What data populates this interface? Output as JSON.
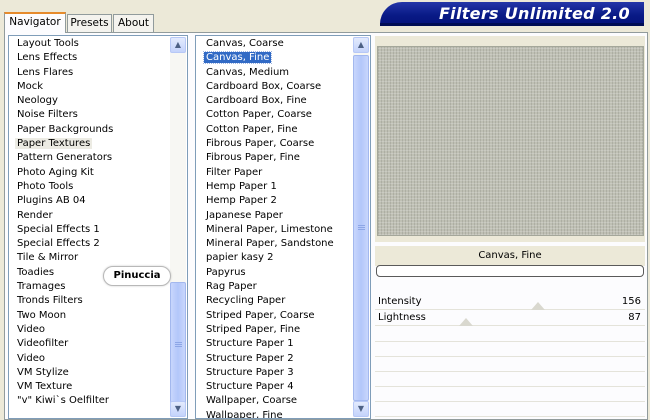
{
  "tabs": {
    "navigator": "Navigator",
    "presets": "Presets",
    "about": "About"
  },
  "title": "Filters Unlimited 2.0",
  "categories": {
    "selected": "Paper Textures",
    "items": [
      "Layout Tools",
      "Lens Effects",
      "Lens Flares",
      "Mock",
      "Neology",
      "Noise Filters",
      "Paper Backgrounds",
      "Paper Textures",
      "Pattern Generators",
      "Photo Aging Kit",
      "Photo Tools",
      "Plugins AB 04",
      "Render",
      "Special Effects 1",
      "Special Effects 2",
      "Tile & Mirror",
      "Toadies",
      "Tramages",
      "Tronds Filters",
      "Two Moon",
      "Video",
      "Videofilter",
      "Video",
      "VM Stylize",
      "VM Texture",
      "\"v\" Kiwi`s Oelfilter"
    ]
  },
  "filters": {
    "selected": "Canvas, Fine",
    "items": [
      "Canvas, Coarse",
      "Canvas, Fine",
      "Canvas, Medium",
      "Cardboard Box, Coarse",
      "Cardboard Box, Fine",
      "Cotton Paper, Coarse",
      "Cotton Paper, Fine",
      "Fibrous Paper, Coarse",
      "Fibrous Paper, Fine",
      "Filter Paper",
      "Hemp Paper 1",
      "Hemp Paper 2",
      "Japanese Paper",
      "Mineral Paper, Limestone",
      "Mineral Paper, Sandstone",
      "papier kasy 2",
      "Papyrus",
      "Rag Paper",
      "Recycling Paper",
      "Striped Paper, Coarse",
      "Striped Paper, Fine",
      "Structure Paper 1",
      "Structure Paper 2",
      "Structure Paper 3",
      "Structure Paper 4",
      "Wallpaper, Coarse",
      "Wallpaper, Fine"
    ]
  },
  "watermark": "Pinuccia",
  "preview": {
    "filter_name": "Canvas, Fine"
  },
  "params": [
    {
      "label": "Intensity",
      "value": "156"
    },
    {
      "label": "Lightness",
      "value": "87"
    }
  ],
  "colors": {
    "banner": "#091a86",
    "selection": "#316ac5",
    "tab_highlight": "#e68b2c",
    "preview_texture": "#bfc0b4"
  },
  "icons": {
    "scroll_up": "chevron-up-icon",
    "scroll_down": "chevron-down-icon"
  }
}
